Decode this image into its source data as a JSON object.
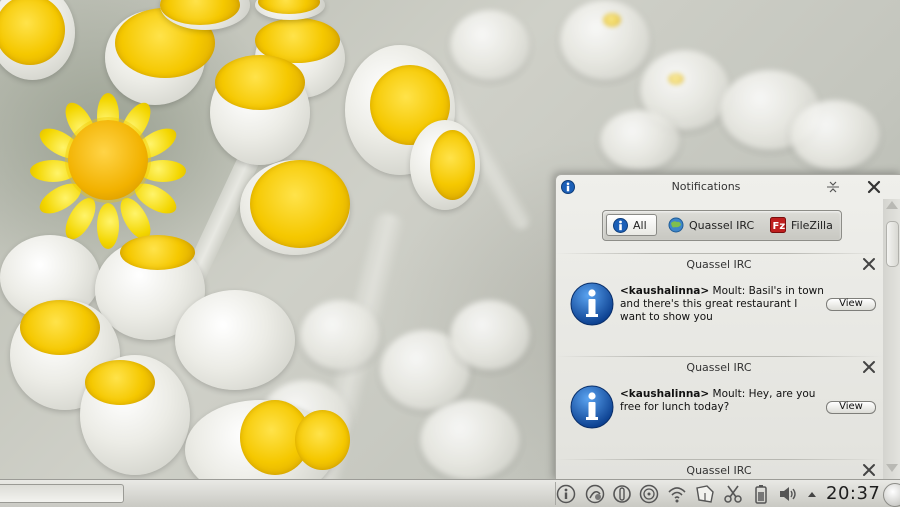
{
  "panel": {
    "title": "Notifications",
    "filters": {
      "all": "All",
      "quassel": "Quassel IRC",
      "filezilla": "FileZilla"
    }
  },
  "notifications": [
    {
      "app": "Quassel IRC",
      "sender": "<kaushalinna>",
      "message": " Moult: Basil's in town and there's this great restaurant I want to show you",
      "action": "View"
    },
    {
      "app": "Quassel IRC",
      "sender": "<kaushalinna>",
      "message": " Moult: Hey, are you free for lunch today?",
      "action": "View"
    },
    {
      "app": "Quassel IRC"
    }
  ],
  "taskbar": {
    "clock": "20:37",
    "tray_icons": [
      "info-icon",
      "network-monitor-icon",
      "power-icon",
      "disc-icon",
      "wifi-icon",
      "notes-icon",
      "clipboard-scissors-icon",
      "battery-icon",
      "volume-icon",
      "expand-tray-arrow-icon"
    ]
  },
  "colors": {
    "panel_bg": "#e8e8e4",
    "info_blue": "#1b5fb7",
    "flower_yellow": "#f5c800"
  }
}
